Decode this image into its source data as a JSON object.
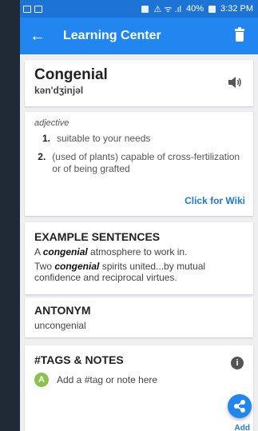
{
  "status_bar": {
    "battery": "40%",
    "time": "3:32 PM"
  },
  "app_bar": {
    "title": "Learning Center"
  },
  "word": {
    "headword": "Congenial",
    "pronunciation": "kən'dʒinjəl"
  },
  "definition": {
    "part_of_speech": "adjective",
    "items": [
      {
        "num": "1.",
        "text": "suitable to your needs"
      },
      {
        "num": "2.",
        "text": "(used of plants) capable of cross-fertilization or of being grafted"
      }
    ],
    "wiki_label": "Click for Wiki"
  },
  "examples": {
    "title": "EXAMPLE SENTENCES",
    "lines": [
      {
        "before": "A ",
        "word": "congenial",
        "after": " atmosphere to work in."
      },
      {
        "before": "Two ",
        "word": "congenial",
        "after": " spirits united...by mutual confidence and reciprocal virtues."
      }
    ]
  },
  "antonym": {
    "title": "ANTONYM",
    "value": "uncongenial"
  },
  "tags": {
    "title": "#TAGS & NOTES",
    "avatar_letter": "A",
    "placeholder": "Add a #tag or note here",
    "add_label": "Add"
  },
  "colors": {
    "primary": "#2286f0",
    "status_bar": "#1e73d6",
    "link": "#1f78d6",
    "avatar": "#8bc34a"
  },
  "icons": {
    "back": "arrow-left-icon",
    "trash": "trash-icon",
    "speaker": "speaker-icon",
    "info": "info-icon",
    "share": "share-icon"
  }
}
